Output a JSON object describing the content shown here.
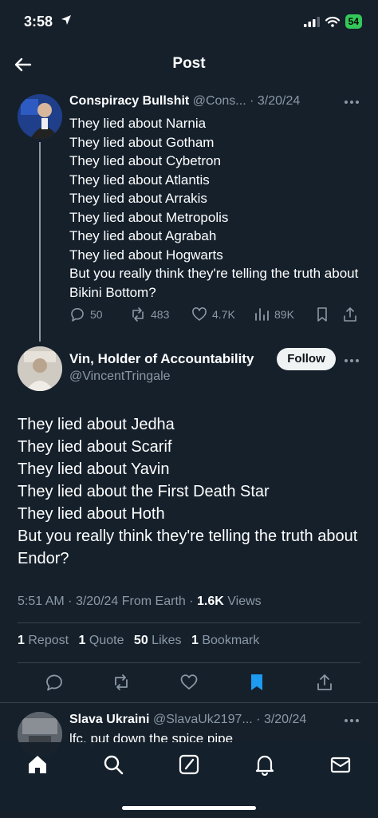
{
  "status_bar": {
    "time": "3:58",
    "battery": "54"
  },
  "header": {
    "title": "Post"
  },
  "parent_tweet": {
    "author_name": "Conspiracy Bullshit",
    "handle": "@Cons...",
    "date": "3/20/24",
    "lines": [
      "They lied about Narnia",
      "They lied about Gotham",
      "They lied about Cybetron",
      "They lied about Atlantis",
      "They lied about Arrakis",
      "They lied about Metropolis",
      "They lied about Agrabah",
      "They lied about Hogwarts",
      "But you really think they're telling the truth about Bikini Bottom?"
    ],
    "replies": "50",
    "reposts": "483",
    "likes": "4.7K",
    "views": "89K"
  },
  "main_tweet": {
    "author_name": "Vin, Holder of Accountability",
    "handle": "@VincentTringale",
    "follow_label": "Follow",
    "lines": [
      "They lied about Jedha",
      "They lied about Scarif",
      "They lied about Yavin",
      "They lied about the First Death Star",
      "They lied about Hoth",
      "But you really think they're telling the truth about Endor?"
    ],
    "time": "5:51 AM",
    "date": "3/20/24",
    "source": "From Earth",
    "views_count": "1.6K",
    "views_label": "Views",
    "stats": {
      "reposts_count": "1",
      "reposts_label": "Repost",
      "quotes_count": "1",
      "quotes_label": "Quote",
      "likes_count": "50",
      "likes_label": "Likes",
      "bookmarks_count": "1",
      "bookmarks_label": "Bookmark"
    }
  },
  "reply_tweet": {
    "author_name": "Slava Ukraini",
    "handle": "@SlavaUk2197...",
    "date": "3/20/24",
    "text": "lfc, put down the spice pipe"
  },
  "colors": {
    "background": "#15202b",
    "accent": "#1d9bf0",
    "muted": "#8b98a5"
  },
  "icons": {
    "tabs": [
      "home-icon",
      "search-icon",
      "compose-icon",
      "bell-icon",
      "mail-icon"
    ]
  }
}
